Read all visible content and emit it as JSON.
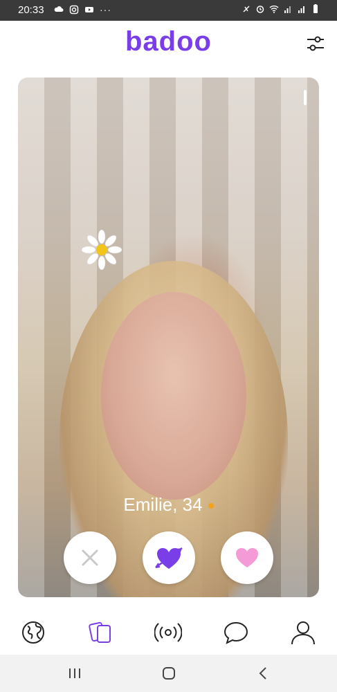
{
  "status_bar": {
    "time": "20:33",
    "left_icons": [
      "cloud-icon",
      "instagram-icon",
      "youtube-icon",
      "more-dots-icon"
    ],
    "right_icons": [
      "mute-icon",
      "alarm-icon",
      "wifi-icon",
      "signal-icon",
      "signal-icon-2",
      "battery-icon"
    ]
  },
  "header": {
    "logo_text": "badoo",
    "filter_icon": "filter-sliders-icon"
  },
  "card": {
    "name_age": "Emilie, 34",
    "online_dot_color": "#f4a21b",
    "actions": [
      {
        "name": "dislike-button",
        "icon": "close-icon"
      },
      {
        "name": "crush-button",
        "icon": "heart-arrow-icon"
      },
      {
        "name": "like-button",
        "icon": "heart-icon"
      }
    ]
  },
  "bottom_nav": {
    "items": [
      {
        "name": "nav-people-nearby",
        "icon": "globe-icon"
      },
      {
        "name": "nav-encounters",
        "icon": "cards-icon",
        "active": true
      },
      {
        "name": "nav-live",
        "icon": "broadcast-icon"
      },
      {
        "name": "nav-messages",
        "icon": "chat-bubble-icon"
      },
      {
        "name": "nav-profile",
        "icon": "person-icon"
      }
    ]
  },
  "system_nav": {
    "items": [
      "recents-icon",
      "home-icon",
      "back-icon"
    ]
  },
  "colors": {
    "brand": "#7a3ee8",
    "like_pink": "#f49ad6",
    "icon_dark": "#222222"
  }
}
